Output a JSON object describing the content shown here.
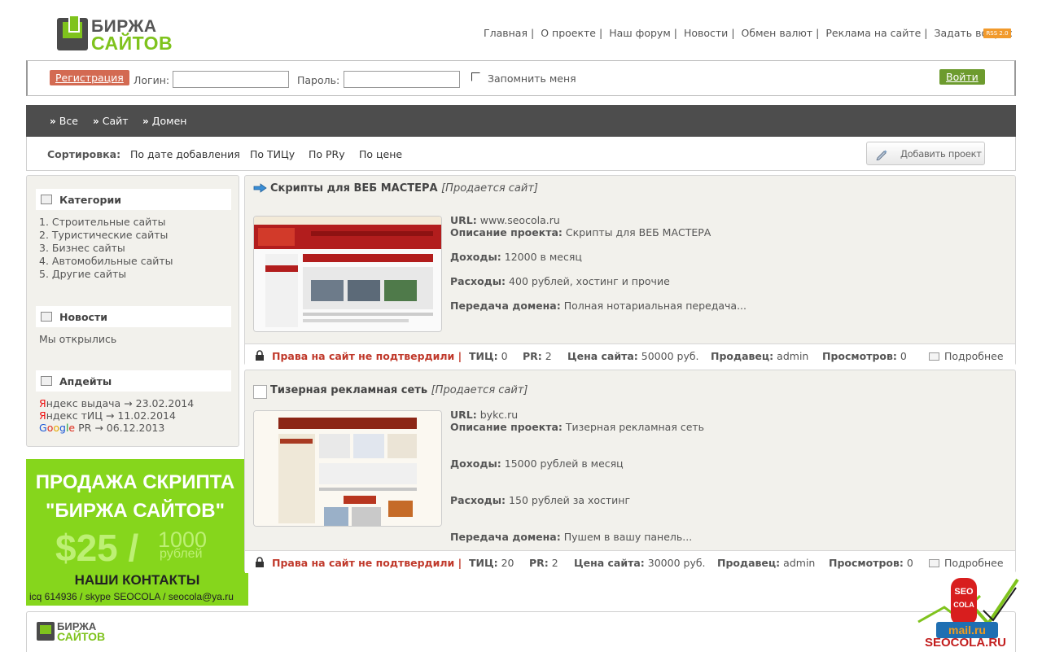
{
  "logo": {
    "line1": "БИРЖА",
    "line2": "САЙТОВ"
  },
  "topnav": {
    "items": [
      "Главная",
      "О проекте",
      "Наш форум",
      "Новости",
      "Обмен валют",
      "Реклама на сайте",
      "Задать вопрос"
    ],
    "rss": "RSS 2.0"
  },
  "login": {
    "register": "Регистрация",
    "login_label": "Логин:",
    "password_label": "Пароль:",
    "remember": "Запомнить меня",
    "submit": "Войти"
  },
  "filters": [
    "Все",
    "Сайт",
    "Домен"
  ],
  "sort": {
    "label": "Сортировка:",
    "items": [
      "По дате добавления",
      "По ТИЦу",
      "По PRу",
      "По цене"
    ],
    "add_project": "Добавить проект"
  },
  "sidebar": {
    "categories_title": "Категории",
    "categories": [
      "1. Строительные сайты",
      "2. Туристические сайты",
      "3. Бизнес сайты",
      "4. Автомобильные сайты",
      "5. Другие сайты"
    ],
    "news_title": "Новости",
    "news": "Мы открылись",
    "updates_title": "Апдейты",
    "updates": [
      {
        "name_first": "Я",
        "name_rest": "ндекс выдача",
        "date": "→ 23.02.2014"
      },
      {
        "name_first": "Я",
        "name_rest": "ндекс тИЦ",
        "date": "→ 11.02.2014"
      },
      {
        "name_rest": " PR",
        "date": "→ 06.12.2013"
      }
    ],
    "google": [
      "G",
      "o",
      "o",
      "g",
      "l",
      "e"
    ]
  },
  "promo": {
    "line1": "ПРОДАЖА СКРИПТА",
    "line2": "\"БИРЖА САЙТОВ\"",
    "price": "$25 /",
    "amount": "1000",
    "unit": "рублей",
    "contacts": "НАШИ КОНТАКТЫ",
    "details": "icq 614936 /  skype SEOCOLA /  seocola@ya.ru"
  },
  "listings": [
    {
      "title": "Скрипты для ВЕБ МАСТЕРА",
      "status": "[Продается сайт]",
      "url_label": "URL:",
      "url": "www.seocola.ru",
      "desc_label": "Описание проекта:",
      "desc": "Скрипты для ВЕБ МАСТЕРА",
      "income_label": "Доходы:",
      "income": "12000 в месяц",
      "expense_label": "Расходы:",
      "expense": "400 рублей, хостинг и прочие",
      "transfer_label": "Передача домена:",
      "transfer": "Полная нотариальная передача...",
      "rights": "Права на сайт не подтвердили |",
      "tic_label": "ТИЦ:",
      "tic": "0",
      "pr_label": "PR:",
      "pr": "2",
      "price_label": "Цена сайта:",
      "price": "50000 руб.",
      "seller_label": "Продавец:",
      "seller": "admin",
      "views_label": "Просмотров:",
      "views": "0",
      "more": "Подробнее"
    },
    {
      "title": "Тизерная рекламная сеть",
      "status": "[Продается сайт]",
      "url_label": "URL:",
      "url": "bykc.ru",
      "desc_label": "Описание проекта:",
      "desc": "Тизерная рекламная сеть",
      "income_label": "Доходы:",
      "income": "15000 рублей в месяц",
      "expense_label": "Расходы:",
      "expense": "150 рублей за хостинг",
      "transfer_label": "Передача домена:",
      "transfer": "Пушем в вашу панель...",
      "rights": "Права на сайт не подтвердили |",
      "tic_label": "ТИЦ:",
      "tic": "20",
      "pr_label": "PR:",
      "pr": "2",
      "price_label": "Цена сайта:",
      "price": "30000 руб.",
      "seller_label": "Продавец:",
      "seller": "admin",
      "views_label": "Просмотров:",
      "views": "0",
      "more": "Подробнее"
    }
  ],
  "footer": {
    "line1": "БИРЖА",
    "line2": "САЙТОВ"
  },
  "badge": {
    "seo": "SEO",
    "cola": "COLA",
    "brand": "SEOCOLA.RU",
    "mail": "mail.ru"
  },
  "colors": {
    "accent_green": "#86d61c",
    "register_red": "#d36a52",
    "login_green": "#6d9b2e",
    "warning_red": "#c0392b",
    "dark_bar": "#4d4d4d"
  }
}
